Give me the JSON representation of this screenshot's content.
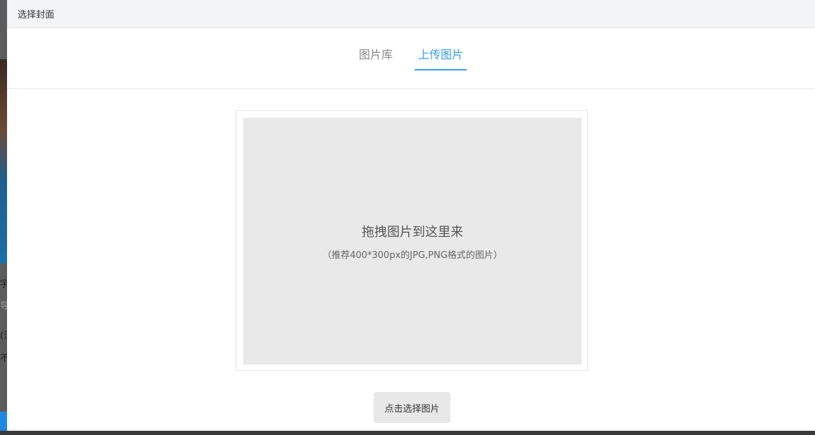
{
  "background": {
    "fragments": [
      "宇",
      "导",
      "(注",
      "不"
    ]
  },
  "modal": {
    "title": "选择封面",
    "tabs": [
      {
        "label": "图片库",
        "active": false
      },
      {
        "label": "上传图片",
        "active": true
      }
    ],
    "upload": {
      "drop_title": "拖拽图片到这里来",
      "drop_hint": "（推荐400*300px的JPG,PNG格式的图片）",
      "choose_button": "点击选择图片"
    }
  },
  "colors": {
    "accent": "#3a9ff0"
  }
}
